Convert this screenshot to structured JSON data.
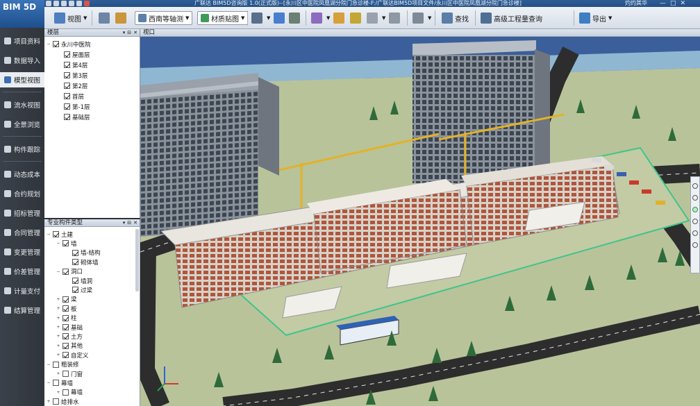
{
  "app": {
    "logo": "BIM 5D",
    "window_title": "广联达 BIM5D咨询版 1.0(正式版)--[永川区中医院凤凰湖分院门急诊楼-F:/广联达BIM5D项目文件/永川区中医院凤凰湖分院门急诊楼]",
    "user": "灼灼其华",
    "controls": [
      "—",
      "□",
      "✕"
    ]
  },
  "toolbar": {
    "view_label": "视图",
    "axis_select": "西南等轴测",
    "material_label": "材质贴图",
    "find_label": "查找",
    "advanced_query_label": "高级工程量查询",
    "export_label": "导出"
  },
  "nav": {
    "items": [
      {
        "label": "项目资料",
        "icon": "folder-icon"
      },
      {
        "label": "数据导入",
        "icon": "import-icon"
      },
      {
        "label": "模型视图",
        "icon": "model-icon",
        "active": true
      },
      {
        "label": "流水视图",
        "icon": "flow-icon"
      },
      {
        "label": "全景浏览",
        "icon": "panorama-icon"
      },
      {
        "label": "构件跟踪",
        "icon": "track-icon"
      },
      {
        "label": "动态成本",
        "icon": "cost-icon"
      },
      {
        "label": "合约规划",
        "icon": "contract-icon"
      },
      {
        "label": "招标管理",
        "icon": "bid-icon"
      },
      {
        "label": "合同管理",
        "icon": "agreement-icon"
      },
      {
        "label": "变更管理",
        "icon": "change-icon"
      },
      {
        "label": "价差管理",
        "icon": "price-icon"
      },
      {
        "label": "计量支付",
        "icon": "payment-icon"
      },
      {
        "label": "结算管理",
        "icon": "settlement-icon"
      }
    ]
  },
  "floors_panel": {
    "title": "楼层",
    "buttons": [
      "▾",
      "⊟",
      "✕"
    ],
    "root": "永川中医院",
    "items": [
      "屋面层",
      "第4层",
      "第3层",
      "第2层",
      "首层",
      "第-1层",
      "基础层"
    ]
  },
  "types_panel": {
    "title": "专业构件类型",
    "buttons": [
      "▾",
      "⊟",
      "✕"
    ],
    "rows": [
      {
        "label": "土建",
        "level": 0,
        "exp": "−",
        "on": true
      },
      {
        "label": "墙",
        "level": 1,
        "exp": "−",
        "on": true
      },
      {
        "label": "墙-结构",
        "level": 2,
        "exp": "",
        "on": true
      },
      {
        "label": "砌体墙",
        "level": 2,
        "exp": "",
        "on": true
      },
      {
        "label": "洞口",
        "level": 1,
        "exp": "−",
        "on": true
      },
      {
        "label": "墙洞",
        "level": 2,
        "exp": "",
        "on": true
      },
      {
        "label": "过梁",
        "level": 2,
        "exp": "",
        "on": true
      },
      {
        "label": "梁",
        "level": 1,
        "exp": "+",
        "on": true
      },
      {
        "label": "板",
        "level": 1,
        "exp": "+",
        "on": true
      },
      {
        "label": "柱",
        "level": 1,
        "exp": "+",
        "on": true
      },
      {
        "label": "基础",
        "level": 1,
        "exp": "+",
        "on": true
      },
      {
        "label": "土方",
        "level": 1,
        "exp": "+",
        "on": true
      },
      {
        "label": "其他",
        "level": 1,
        "exp": "+",
        "on": true
      },
      {
        "label": "自定义",
        "level": 1,
        "exp": "+",
        "on": true
      },
      {
        "label": "粗装修",
        "level": 0,
        "exp": "−",
        "on": false
      },
      {
        "label": "门窗",
        "level": 1,
        "exp": "+",
        "on": false
      },
      {
        "label": "幕墙",
        "level": 0,
        "exp": "−",
        "on": false
      },
      {
        "label": "幕墙",
        "level": 1,
        "exp": "+",
        "on": false
      },
      {
        "label": "给排水",
        "level": 0,
        "exp": "+",
        "on": false
      }
    ]
  },
  "viewport": {
    "title": "视口"
  },
  "colors": {
    "sky": "#3a5f9a",
    "water": "#8fb7d2",
    "ground": "#b9c39a",
    "road": "#2d2d2d",
    "building": "#7f8791"
  }
}
